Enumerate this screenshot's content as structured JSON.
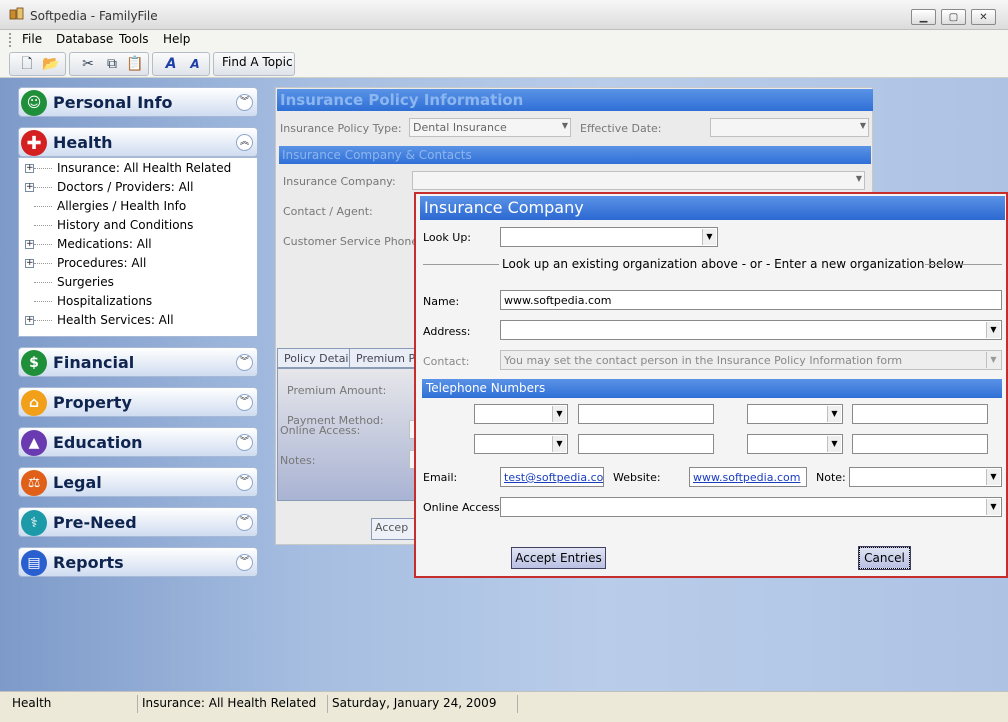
{
  "window": {
    "title": "Softpedia - FamilyFile"
  },
  "menu": [
    "File",
    "Database",
    "Tools",
    "Help"
  ],
  "toolbar": {
    "find_topic": "Find A Topic"
  },
  "nav": {
    "sections": [
      {
        "label": "Personal Info",
        "icon": "person-icon",
        "color": "#1f8f3a"
      },
      {
        "label": "Health",
        "icon": "red-cross-icon",
        "color": "#d42020"
      },
      {
        "label": "Financial",
        "icon": "dollar-icon",
        "color": "#1f8f3a"
      },
      {
        "label": "Property",
        "icon": "house-icon",
        "color": "#f2a01a"
      },
      {
        "label": "Education",
        "icon": "graduation-cap-icon",
        "color": "#6a3bb0"
      },
      {
        "label": "Legal",
        "icon": "scales-icon",
        "color": "#e0601a"
      },
      {
        "label": "Pre-Need",
        "icon": "caduceus-icon",
        "color": "#1c9aa8"
      },
      {
        "label": "Reports",
        "icon": "report-icon",
        "color": "#2a5fd0"
      }
    ],
    "health_items": [
      {
        "label": "Insurance: All Health Related",
        "expandable": true
      },
      {
        "label": "Doctors / Providers: All",
        "expandable": true
      },
      {
        "label": "Allergies / Health Info",
        "expandable": false
      },
      {
        "label": "History and Conditions",
        "expandable": false
      },
      {
        "label": "Medications: All",
        "expandable": true
      },
      {
        "label": "Procedures: All",
        "expandable": true
      },
      {
        "label": "Surgeries",
        "expandable": false
      },
      {
        "label": "Hospitalizations",
        "expandable": false
      },
      {
        "label": "Health Services: All",
        "expandable": true
      }
    ]
  },
  "policy_form": {
    "title": "Insurance Policy Information",
    "policy_type_label": "Insurance Policy Type:",
    "policy_type_value": "Dental Insurance",
    "effective_date_label": "Effective Date:",
    "company_section": "Insurance Company & Contacts",
    "company_label": "Insurance Company:",
    "contact_label": "Contact / Agent:",
    "phone_label": "Customer Service  Phone:",
    "tabs": [
      "Policy Details",
      "Premium Pay"
    ],
    "premium_amount_label": "Premium Amount:",
    "payment_method_label": "Payment Method:",
    "online_access_label": "Online Access:",
    "notes_label": "Notes:",
    "accept_partial": "Accep"
  },
  "dialog": {
    "title": "Insurance Company",
    "lookup_label": "Look Up:",
    "divider_text": "Look up an existing organization above - or - Enter a new organization below",
    "name_label": "Name:",
    "name_value": "www.softpedia.com",
    "address_label": "Address:",
    "contact_label": "Contact:",
    "contact_placeholder": "You may set the contact person in the Insurance Policy Information form",
    "telephone_header": "Telephone Numbers",
    "email_label": "Email:",
    "email_value": "test@softpedia.com",
    "website_label": "Website:",
    "website_value": "www.softpedia.com",
    "note_label": "Note:",
    "online_access_label": "Online Access:",
    "accept_button": "Accept Entries",
    "cancel_button": "Cancel"
  },
  "status": {
    "section": "Health",
    "item": "Insurance: All Health Related",
    "date": "Saturday, January 24, 2009"
  }
}
